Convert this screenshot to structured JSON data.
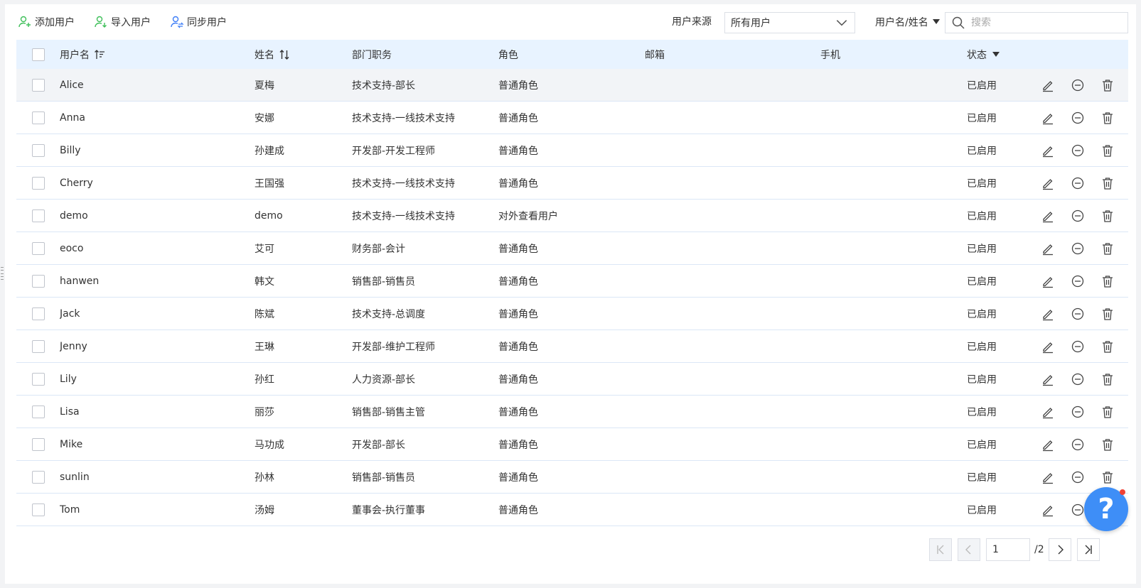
{
  "toolbar": {
    "add_label": "添加用户",
    "import_label": "导入用户",
    "sync_label": "同步用户",
    "source_label": "用户来源",
    "source_value": "所有用户",
    "field_label": "用户名/姓名",
    "search_placeholder": "搜索"
  },
  "columns": {
    "username": "用户名",
    "name": "姓名",
    "dept": "部门职务",
    "role": "角色",
    "email": "邮箱",
    "phone": "手机",
    "status": "状态"
  },
  "rows": [
    {
      "username": "Alice",
      "name": "夏梅",
      "dept": "技术支持-部长",
      "role": "普通角色",
      "email": "",
      "phone": "",
      "status": "已启用"
    },
    {
      "username": "Anna",
      "name": "安娜",
      "dept": "技术支持-一线技术支持",
      "role": "普通角色",
      "email": "",
      "phone": "",
      "status": "已启用"
    },
    {
      "username": "Billy",
      "name": "孙建成",
      "dept": "开发部-开发工程师",
      "role": "普通角色",
      "email": "",
      "phone": "",
      "status": "已启用"
    },
    {
      "username": "Cherry",
      "name": "王国强",
      "dept": "技术支持-一线技术支持",
      "role": "普通角色",
      "email": "",
      "phone": "",
      "status": "已启用"
    },
    {
      "username": "demo",
      "name": "demo",
      "dept": "技术支持-一线技术支持",
      "role": "对外查看用户",
      "email": "",
      "phone": "",
      "status": "已启用"
    },
    {
      "username": "eoco",
      "name": "艾可",
      "dept": "财务部-会计",
      "role": "普通角色",
      "email": "",
      "phone": "",
      "status": "已启用"
    },
    {
      "username": "hanwen",
      "name": "韩文",
      "dept": "销售部-销售员",
      "role": "普通角色",
      "email": "",
      "phone": "",
      "status": "已启用"
    },
    {
      "username": "Jack",
      "name": "陈斌",
      "dept": "技术支持-总调度",
      "role": "普通角色",
      "email": "",
      "phone": "",
      "status": "已启用"
    },
    {
      "username": "Jenny",
      "name": "王琳",
      "dept": "开发部-维护工程师",
      "role": "普通角色",
      "email": "",
      "phone": "",
      "status": "已启用"
    },
    {
      "username": "Lily",
      "name": "孙红",
      "dept": "人力资源-部长",
      "role": "普通角色",
      "email": "",
      "phone": "",
      "status": "已启用"
    },
    {
      "username": "Lisa",
      "name": "丽莎",
      "dept": "销售部-销售主管",
      "role": "普通角色",
      "email": "",
      "phone": "",
      "status": "已启用"
    },
    {
      "username": "Mike",
      "name": "马功成",
      "dept": "开发部-部长",
      "role": "普通角色",
      "email": "",
      "phone": "",
      "status": "已启用"
    },
    {
      "username": "sunlin",
      "name": "孙林",
      "dept": "销售部-销售员",
      "role": "普通角色",
      "email": "",
      "phone": "",
      "status": "已启用"
    },
    {
      "username": "Tom",
      "name": "汤姆",
      "dept": "董事会-执行董事",
      "role": "普通角色",
      "email": "",
      "phone": "",
      "status": "已启用"
    }
  ],
  "pagination": {
    "current_page": "1",
    "total_label": "/2"
  },
  "help": {
    "label": "?"
  },
  "colors": {
    "header_bg": "#e8f3ff",
    "add_icon": "#3fbf5a",
    "sync_icon": "#3e7ef7",
    "help_button": "#3e8ef7"
  }
}
